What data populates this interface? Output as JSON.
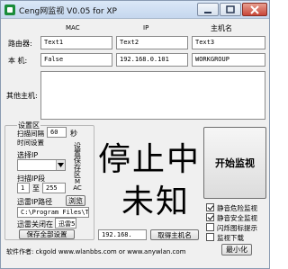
{
  "window": {
    "title": "Ceng网监视 V0.05 for XP",
    "icon": "app-icon"
  },
  "columns": {
    "mac": "MAC",
    "ip": "IP",
    "hostname": "主机名"
  },
  "rows": {
    "router": {
      "label": "路由器:",
      "mac": "Text1",
      "ip": "Text2",
      "hostname": "Text3"
    },
    "local": {
      "label": "本  机:",
      "mac": "False",
      "ip": "192.168.0.101",
      "hostname": "WORKGROUP"
    }
  },
  "other_hosts": {
    "label": "其他主机:"
  },
  "settings": {
    "group_title": "设置区",
    "scan_interval_label": "扫描间隔",
    "scan_interval_value": "60",
    "scan_interval_unit": "秒",
    "time_settings_label": "时间设置",
    "select_ip_label": "选择IP",
    "select_ip_value": "",
    "scan_ip_range_label": "扫描IP段",
    "range_from": "1",
    "range_to_label": "至",
    "range_to": "255",
    "settings_save_vertical": "设置保存区",
    "mac_vertical": "MAC",
    "thunder_path_label": "迅雷IP路径",
    "browse_button": "浏览",
    "thunder_path_value": "C:\\Program Files\\T",
    "thunder_close_label": "迅雷关闭在",
    "thunder_close_value": "迅雷5",
    "save_button": "保存全部设置"
  },
  "status": {
    "line1": "停止中",
    "line2": "未知"
  },
  "start_button": "开始监视",
  "ip_input": "192.168.",
  "get_hostname_button": "取得主机名",
  "options": [
    {
      "label": "静音危险监视",
      "checked": true
    },
    {
      "label": "静音安全监视",
      "checked": true
    },
    {
      "label": "闪烁图标提示",
      "checked": false
    },
    {
      "label": "监视下载",
      "checked": false
    }
  ],
  "minimize_button": "最小化",
  "footer": "软件作者: ckgold   www.wlanbbs.com  or  www.anywlan.com"
}
